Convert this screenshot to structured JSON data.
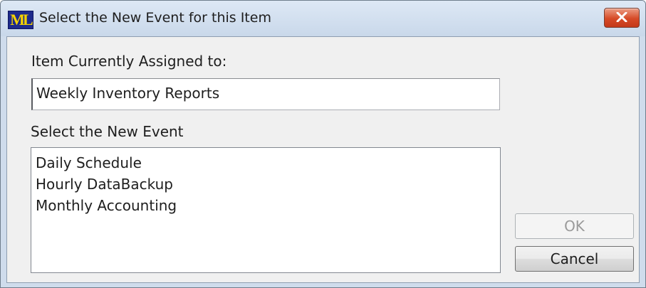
{
  "window": {
    "title": "Select the New Event for this Item",
    "logo_text": "ML",
    "close_icon": "close-x-icon"
  },
  "assigned": {
    "label": "Item Currently Assigned to:",
    "value": "Weekly Inventory Reports"
  },
  "events": {
    "label": "Select the New Event",
    "items": [
      "Daily Schedule",
      "Hourly DataBackup",
      "Monthly Accounting"
    ]
  },
  "buttons": {
    "ok_label": "OK",
    "ok_enabled": false,
    "cancel_label": "Cancel"
  },
  "colors": {
    "close_button": "#d64a26",
    "logo_bg": "#1d2a8c",
    "logo_fg": "#f5d200",
    "frame": "#cfdcec"
  }
}
